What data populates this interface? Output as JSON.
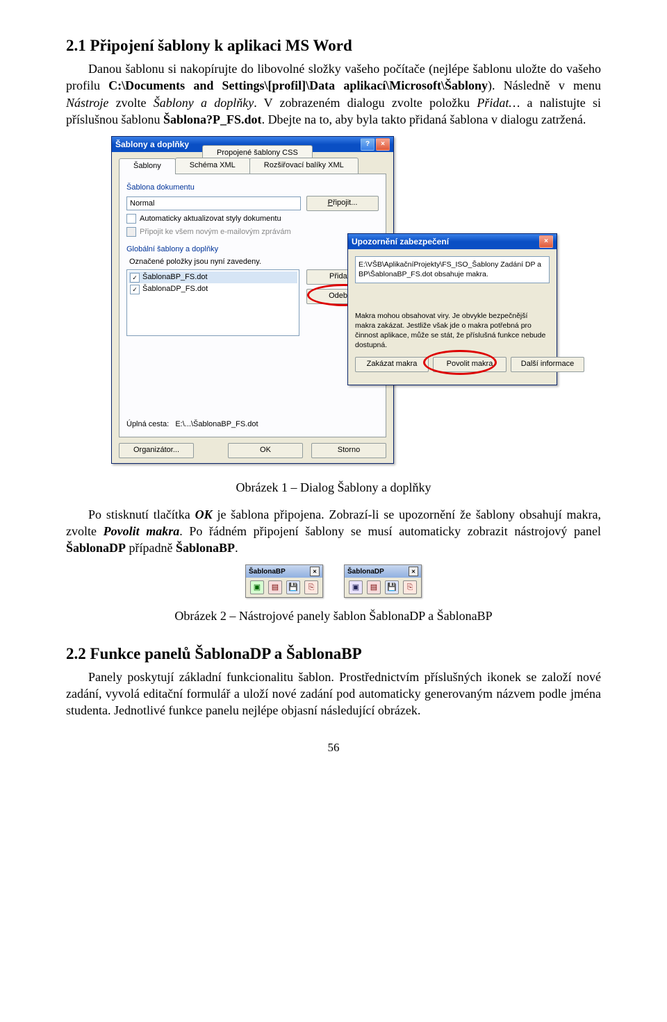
{
  "section1": {
    "heading": "2.1 Připojení šablony k aplikaci MS Word",
    "p1a": "Danou šablonu si nakopírujte do libovolné složky vašeho počítače (nejlépe šablonu uložte do vašeho profilu ",
    "p1b": "C:\\Documents and Settings\\[profil]\\Data aplikací\\Microsoft\\Šablony",
    "p1c": "). Následně v menu ",
    "p1d": "Nástroje",
    "p1e": " zvolte ",
    "p1f": "Šablony a doplňky",
    "p1g": ". V zobrazeném dialogu zvolte položku ",
    "p1h": "Přidat…",
    "p1i": " a nalistujte si příslušnou šablonu ",
    "p1j": "Šablona?P_FS.dot",
    "p1k": ". Dbejte na to, aby byla takto přidaná šablona v dialogu zatržená."
  },
  "dialog": {
    "title": "Šablony a doplňky",
    "tabs": {
      "t1": "Šablony",
      "t2": "Schéma XML",
      "t3": "Propojené šablony CSS",
      "t4": "Rozšiřovací balíky XML"
    },
    "grp1": "Šablona dokumentu",
    "docTemplate": "Normal",
    "btnAttach": "Připojit...",
    "chk1": "Automaticky aktualizovat styly dokumentu",
    "chk2": "Připojit ke všem novým e-mailovým zprávám",
    "grp2": "Globální šablony a doplňky",
    "grp2sub": "Označené položky jsou nyní zavedeny.",
    "item1": "ŠablonaBP_FS.dot",
    "item2": "ŠablonaDP_FS.dot",
    "btnAdd": "Přidat...",
    "btnRemove": "Odebrat",
    "fullPathLabel": "Úplná cesta:",
    "fullPath": "E:\\...\\ŠablonaBP_FS.dot",
    "btnOrganizer": "Organizátor...",
    "btnOK": "OK",
    "btnCancel": "Storno"
  },
  "sec": {
    "title": "Upozornění zabezpečení",
    "line1": "E:\\VŠB\\AplikačníProjekty\\FS_ISO_Šablony  Zadání DP a BP\\ŠablonaBP_FS.dot obsahuje makra.",
    "line2": "Makra mohou obsahovat viry. Je obvykle bezpečnější makra zakázat. Jestliže však jde o makra potřebná pro činnost aplikace, může se stát, že příslušná funkce nebude dostupná.",
    "btnDisable": "Zakázat makra",
    "btnEnable": "Povolit makra",
    "btnMore": "Další informace"
  },
  "caption1": "Obrázek 1 – Dialog Šablony a doplňky",
  "p2": {
    "a": "Po stisknutí tlačítka ",
    "b": "OK",
    "c": " je šablona připojena. Zobrazí-li se upozornění že šablony obsahují makra, zvolte ",
    "d": "Povolit makra",
    "e": ". Po řádném připojení šablony se musí automaticky zobrazit nástrojový panel ",
    "f": "ŠablonaDP",
    "g": " případně ",
    "h": "ŠablonaBP",
    "i": "."
  },
  "tbar1": {
    "title": "ŠablonaBP"
  },
  "tbar2": {
    "title": "ŠablonaDP"
  },
  "caption2": "Obrázek 2 – Nástrojové panely šablon ŠablonaDP a ŠablonaBP",
  "section2": {
    "heading": "2.2 Funkce panelů ŠablonaDP a ŠablonaBP",
    "p": "Panely poskytují základní funkcionalitu šablon. Prostřednictvím příslušných ikonek se založí nové zadání, vyvolá editační formulář a uloží nové zadání pod automaticky generovaným názvem podle jména studenta. Jednotlivé funkce panelu nejlépe objasní následující obrázek."
  },
  "pagenum": "56"
}
